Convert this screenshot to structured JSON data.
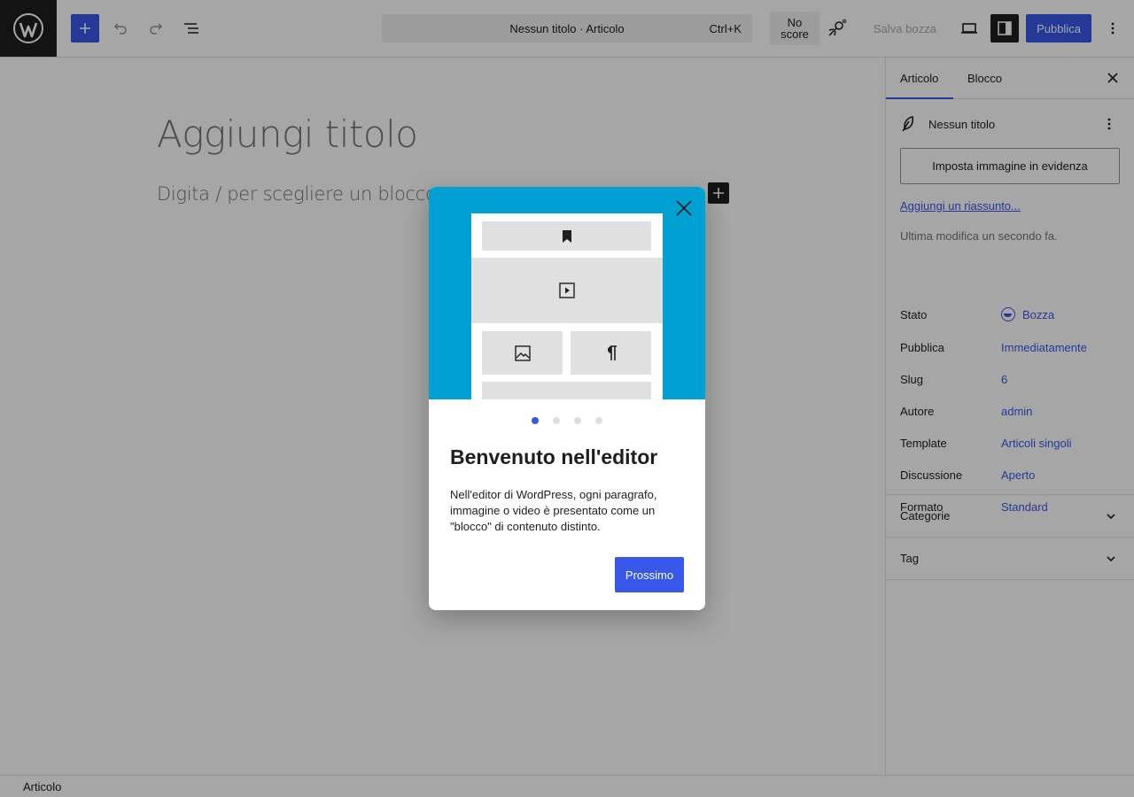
{
  "topbar": {
    "doc_title": "Nessun titolo · Articolo",
    "shortcut": "Ctrl+K",
    "score": "No\nscore",
    "save_draft": "Salva bozza",
    "publish": "Pubblica"
  },
  "canvas": {
    "title_placeholder": "Aggiungi titolo",
    "body_placeholder": "Digita / per scegliere un blocco"
  },
  "sidebar": {
    "tabs": [
      {
        "label": "Articolo",
        "active": true
      },
      {
        "label": "Blocco",
        "active": false
      }
    ],
    "post_name": "Nessun titolo",
    "featured_image": "Imposta immagine in evidenza",
    "excerpt_link": "Aggiungi un riassunto...",
    "last_modified": "Ultima modifica un secondo fa.",
    "meta": [
      {
        "label": "Stato",
        "value": "Bozza"
      },
      {
        "label": "Pubblica",
        "value": "Immediatamente"
      },
      {
        "label": "Slug",
        "value": "6"
      },
      {
        "label": "Autore",
        "value": "admin"
      },
      {
        "label": "Template",
        "value": "Articoli singoli"
      },
      {
        "label": "Discussione",
        "value": "Aperto"
      },
      {
        "label": "Formato",
        "value": "Standard"
      }
    ],
    "panels": [
      {
        "label": "Categorie"
      },
      {
        "label": "Tag"
      }
    ]
  },
  "footer": {
    "breadcrumb": "Articolo"
  },
  "modal": {
    "title": "Benvenuto nell'editor",
    "text": "Nell'editor di WordPress, ogni paragrafo, immagine o video è presentato come un \"blocco\" di contenuto distinto.",
    "next_label": "Prossimo",
    "page_count": 4,
    "current_page": 1
  },
  "colors": {
    "accent": "#3858e9",
    "illustration_bg": "#00a0d2",
    "dark": "#1e1e1e"
  }
}
